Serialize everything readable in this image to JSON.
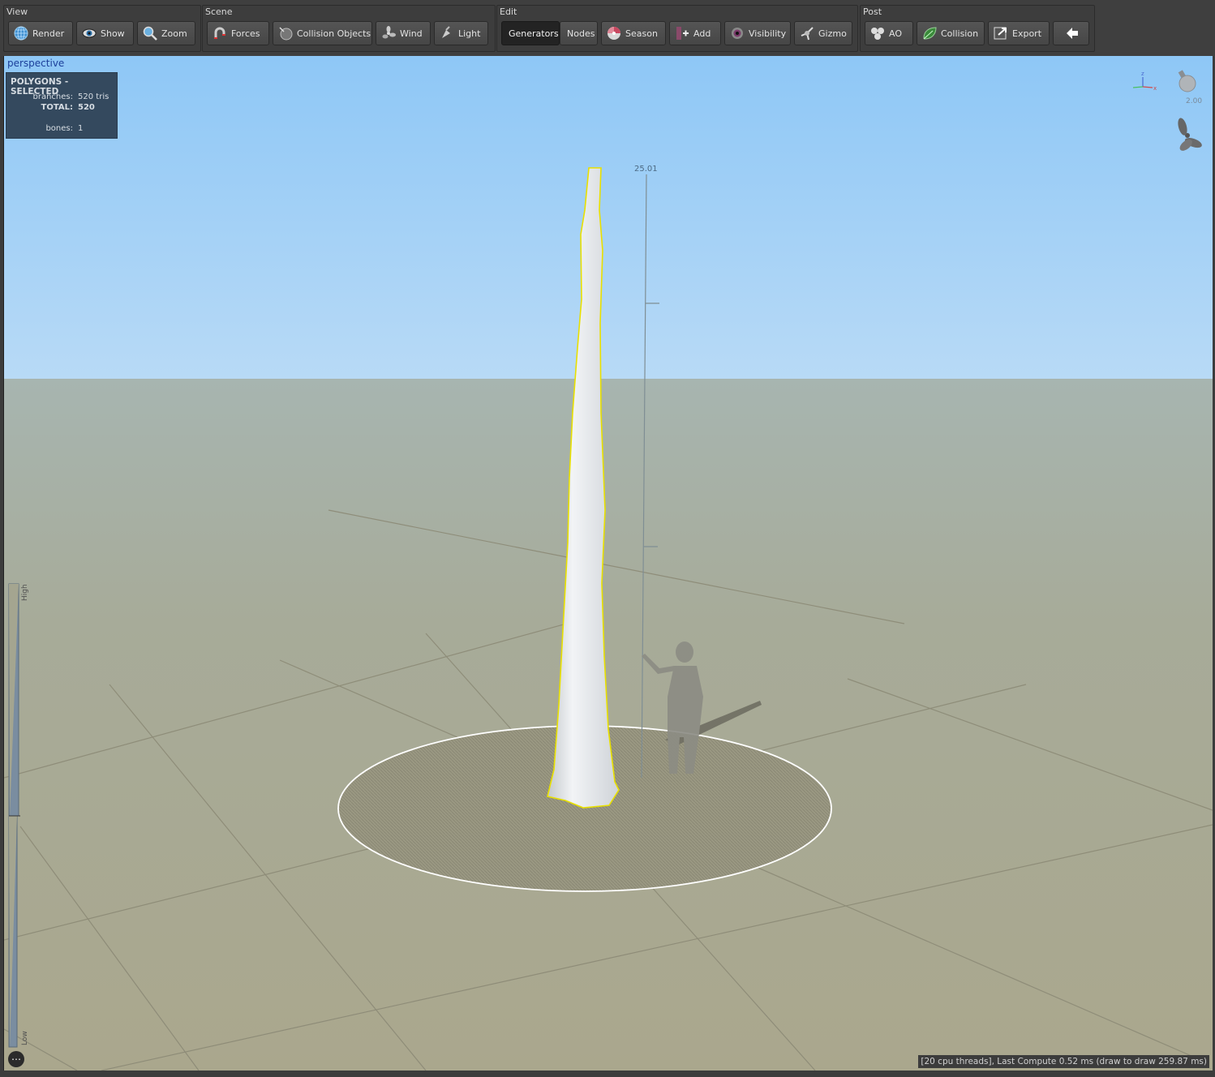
{
  "toolbar": {
    "view": {
      "label": "View",
      "render": "Render",
      "show": "Show",
      "zoom": "Zoom"
    },
    "scene": {
      "label": "Scene",
      "forces": "Forces",
      "collision_objects": "Collision Objects",
      "wind": "Wind",
      "light": "Light"
    },
    "edit": {
      "label": "Edit",
      "generators": "Generators",
      "nodes": "Nodes",
      "season": "Season",
      "add": "Add",
      "visibility": "Visibility",
      "gizmo": "Gizmo",
      "active_tab": "Generators"
    },
    "post": {
      "label": "Post",
      "ao": "AO",
      "collision": "Collision",
      "export": "Export",
      "back_icon": "arrow-left-icon"
    }
  },
  "viewport": {
    "camera_label": "perspective",
    "stats": {
      "header": "POLYGONS - SELECTED",
      "branches_label": "branches:",
      "branches_value": "520",
      "branches_unit": "tris",
      "total_label": "TOTAL:",
      "total_value": "520",
      "bones_label": "bones:",
      "bones_value": "1"
    },
    "height_marker": "25.01",
    "light_intensity": "2.00",
    "lod_high": "High",
    "lod_low": "Low",
    "more_icon": "ellipsis-icon",
    "status": "[20 cpu threads], Last Compute 0.52 ms (draw to draw 259.87 ms)",
    "colors": {
      "sky_top": "#8fc8f5",
      "sky_horizon": "#b5d9f8",
      "ground": "#a8a78f",
      "selection": "#e8e000"
    }
  }
}
